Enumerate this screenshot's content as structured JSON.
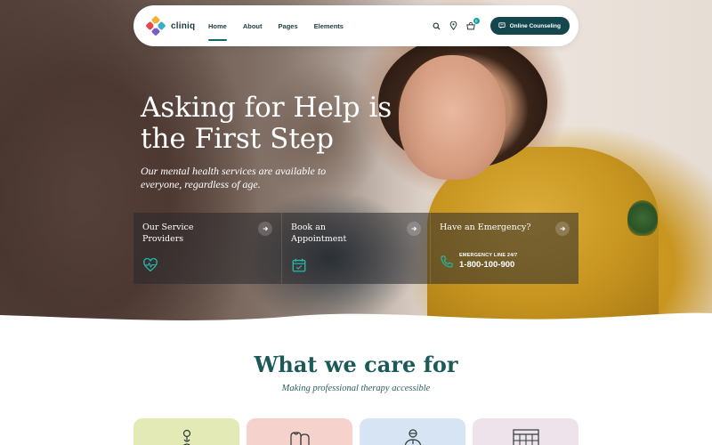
{
  "header": {
    "brand": "cliniq",
    "nav": [
      {
        "label": "Home",
        "active": true
      },
      {
        "label": "About",
        "active": false
      },
      {
        "label": "Pages",
        "active": false
      },
      {
        "label": "Elements",
        "active": false
      }
    ],
    "icons": [
      "search-icon",
      "map-pin-icon",
      "cart-icon"
    ],
    "cart_count": "0",
    "cta_label": "Online Counseling"
  },
  "hero": {
    "title": "Asking for Help is the First Step",
    "subtitle": "Our mental health services are available to everyone, regardless of age.",
    "cards": [
      {
        "title": "Our Service Providers",
        "icon": "heart-pulse-icon"
      },
      {
        "title": "Book an Appointment",
        "icon": "calendar-icon"
      },
      {
        "title": "Have an Emergency?",
        "icon": "phone-icon",
        "emergency_label": "EMERGENCY LINE 24/7",
        "emergency_phone": "1-800-100-900"
      }
    ]
  },
  "care": {
    "title": "What we care for",
    "subtitle": "Making professional therapy accessible",
    "cards": [
      {
        "icon": "person-icon",
        "color": "#e3eab6"
      },
      {
        "icon": "family-icon",
        "color": "#f6d2cc"
      },
      {
        "icon": "doctor-icon",
        "color": "#d7e4f3"
      },
      {
        "icon": "calendar-grid-icon",
        "color": "#eee3ea"
      }
    ]
  },
  "colors": {
    "accent": "#13474d",
    "teal": "#1aa39a",
    "heading": "#1c5a5a"
  }
}
